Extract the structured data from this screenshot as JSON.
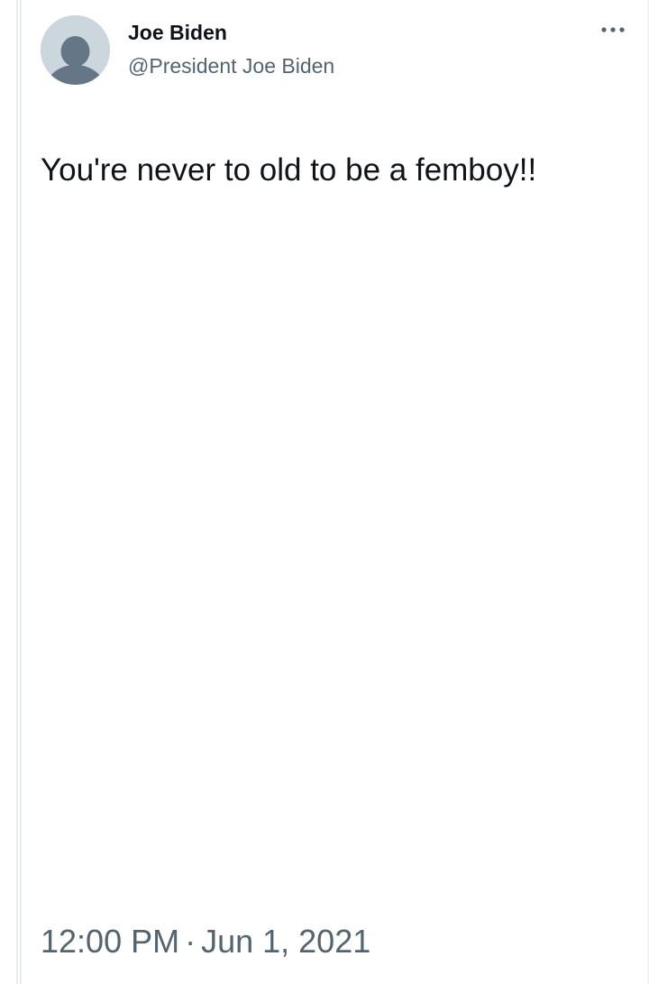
{
  "tweet": {
    "author": {
      "display_name": "Joe Biden",
      "handle": "@President Joe Biden",
      "avatar_icon": "default-avatar-icon"
    },
    "more_icon": "more-options-icon",
    "text": "You're never to old to be a femboy!!",
    "time": "12:00 PM",
    "separator": "·",
    "date": "Jun 1, 2021"
  },
  "colors": {
    "text_primary": "#0f1419",
    "text_secondary": "#536471",
    "avatar_bg": "#ccd6dd",
    "avatar_fg": "#657786"
  }
}
